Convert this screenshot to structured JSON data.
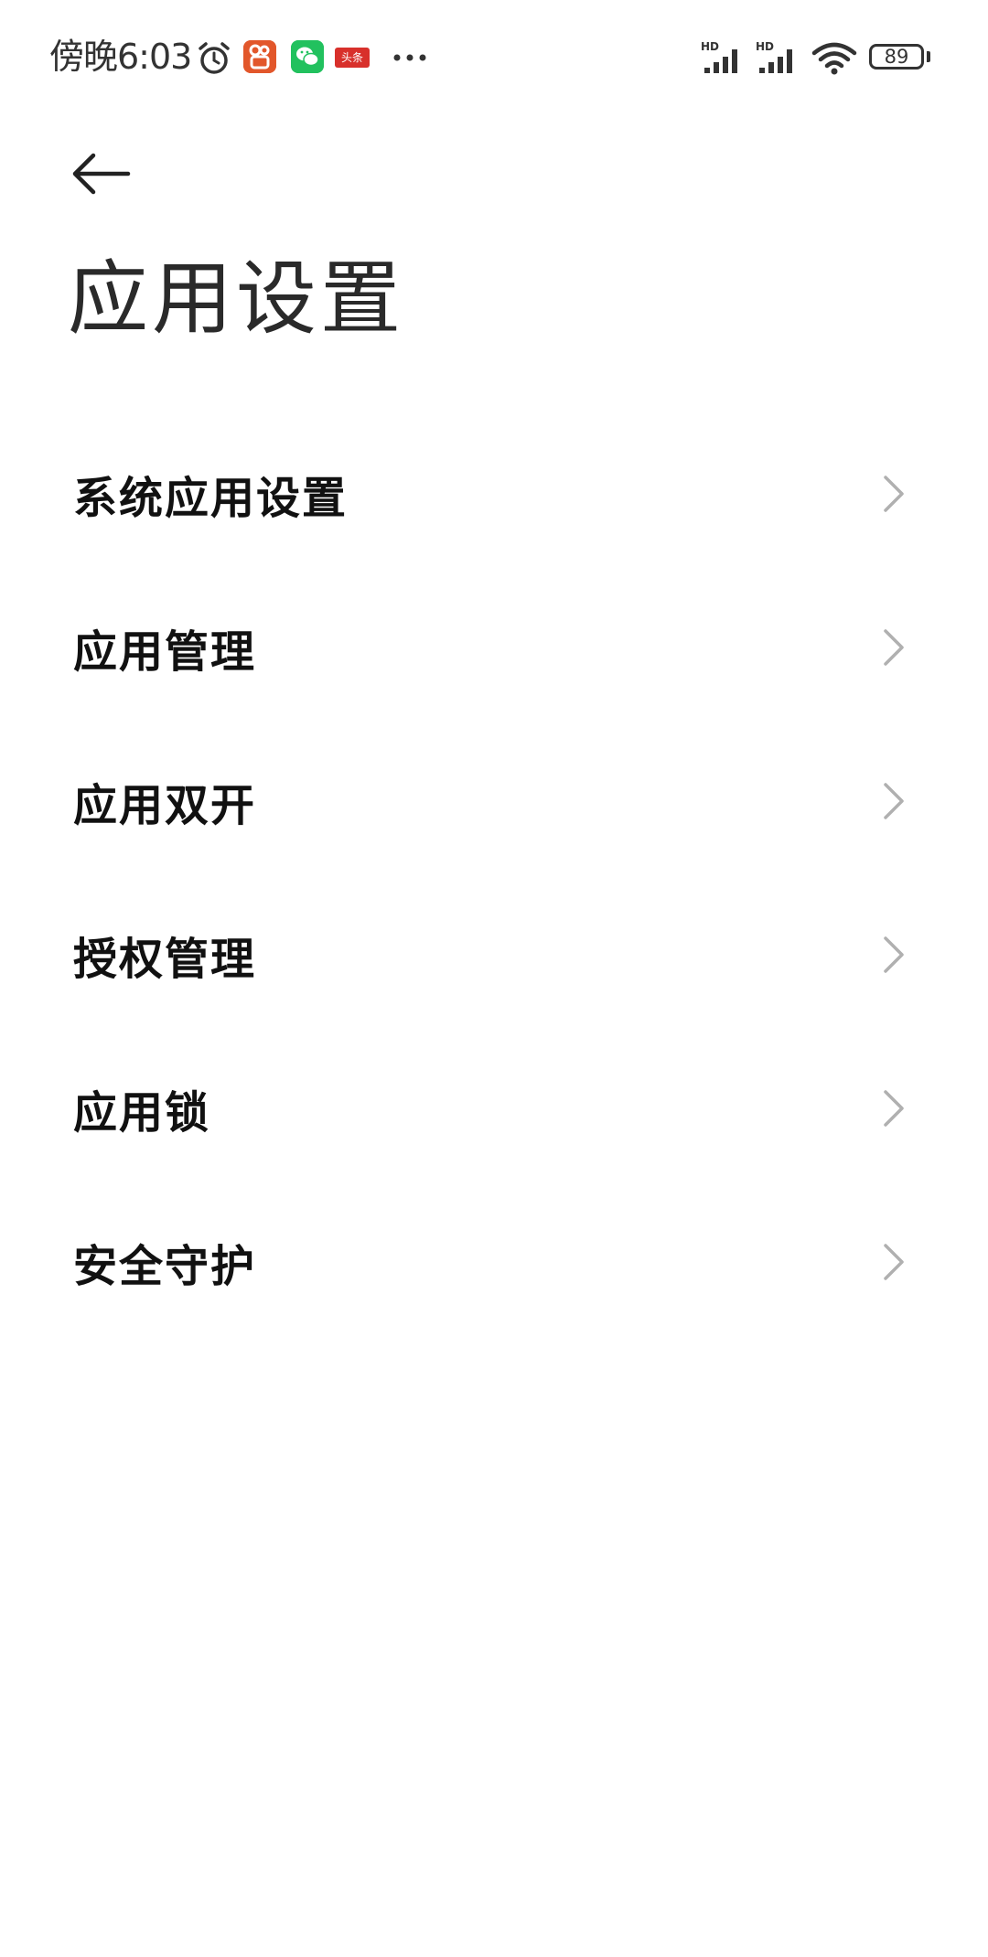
{
  "status_bar": {
    "time": "傍晚6:03",
    "toutiao_badge": "头条",
    "battery_level": "89",
    "icons": [
      "alarm-icon",
      "kuaishou-app-icon",
      "wechat-app-icon",
      "toutiao-app-icon",
      "more-notifications-icon",
      "hd-signal-icon",
      "hd-signal-icon",
      "wifi-icon",
      "battery-icon"
    ]
  },
  "header": {
    "back_icon": "arrow-left-icon",
    "title": "应用设置"
  },
  "settings": {
    "items": [
      {
        "label": "系统应用设置"
      },
      {
        "label": "应用管理"
      },
      {
        "label": "应用双开"
      },
      {
        "label": "授权管理"
      },
      {
        "label": "应用锁"
      },
      {
        "label": "安全守护"
      }
    ],
    "chevron_icon": "chevron-right-icon"
  },
  "colors": {
    "background": "#ffffff",
    "text_primary": "#111111",
    "chevron": "#b0b0b0",
    "kuaishou": "#e2572b",
    "wechat": "#22c15e",
    "toutiao": "#d8302b"
  }
}
